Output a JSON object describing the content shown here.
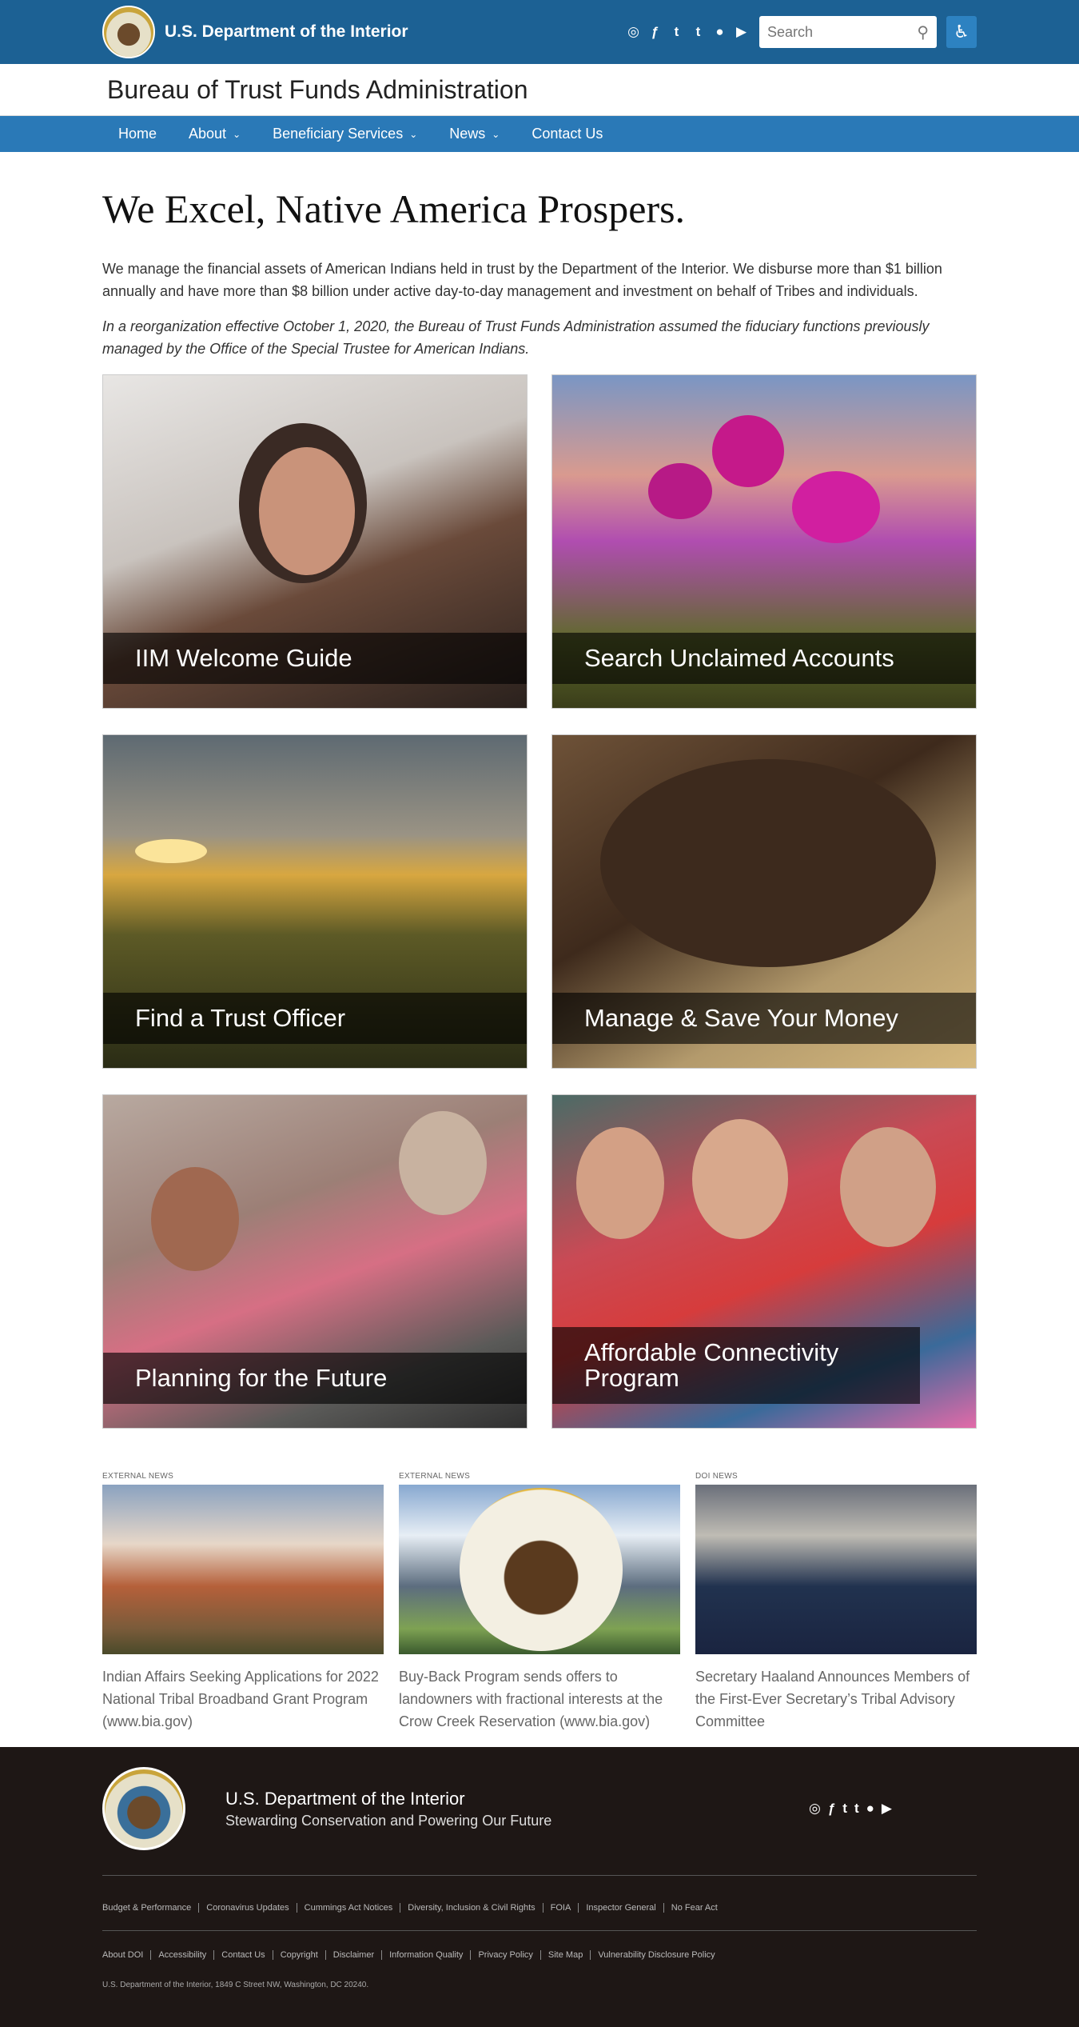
{
  "header": {
    "dept_name": "U.S. Department of the Interior",
    "search_placeholder": "Search",
    "social_icons": [
      "instagram-icon",
      "facebook-icon",
      "twitter-icon",
      "tumblr-icon",
      "flickr-icon",
      "youtube-icon"
    ],
    "bureau_name": "Bureau of Trust Funds Administration"
  },
  "nav": {
    "items": [
      {
        "label": "Home"
      },
      {
        "label": "About"
      },
      {
        "label": "Beneficiary Services"
      },
      {
        "label": "News"
      },
      {
        "label": "Contact Us"
      }
    ]
  },
  "main": {
    "headline": "We Excel, Native America Prospers.",
    "para1": "We manage the financial assets of American Indians held in trust by the Department of the Interior. We disburse more than $1 billion annually and have more than $8 billion under active day-to-day management and investment on behalf of Tribes and individuals.",
    "para2_prefix": "In a ",
    "para2_link": "reorganization effective October 1, 2020",
    "para2_suffix": ", the Bureau of Trust Funds Administration assumed the fiduciary functions previously managed by the Office of the Special Trustee for American Indians.",
    "tiles": [
      {
        "label": "IIM Welcome Guide"
      },
      {
        "label": "Search Unclaimed Accounts"
      },
      {
        "label": "Find a Trust Officer"
      },
      {
        "label": "Manage & Save Your Money"
      },
      {
        "label": "Planning for the Future"
      },
      {
        "label": "Affordable Connectivity Program"
      }
    ]
  },
  "news": [
    {
      "tag": "EXTERNAL NEWS",
      "title": "Indian Affairs Seeking Applications for 2022 National Tribal Broadband Grant Program (www.bia.gov)"
    },
    {
      "tag": "EXTERNAL NEWS",
      "title": "Buy-Back Program sends offers to landowners with fractional interests at the Crow Creek Reservation (www.bia.gov)"
    },
    {
      "tag": "DOI NEWS",
      "title": "Secretary Haaland Announces Members of the First-Ever Secretary’s Tribal Advisory Committee"
    }
  ],
  "footer": {
    "dept_name": "U.S. Department of the Interior",
    "tagline": "Stewarding Conservation and Powering Our Future",
    "links_row1": [
      "Budget & Performance",
      "Coronavirus Updates",
      "Cummings Act Notices",
      "Diversity, Inclusion & Civil Rights",
      "FOIA",
      "Inspector General",
      "No Fear Act"
    ],
    "links_row2": [
      "About DOI",
      "Accessibility",
      "Contact Us",
      "Copyright",
      "Disclaimer",
      "Information Quality",
      "Privacy Policy",
      "Site Map",
      "Vulnerability Disclosure Policy"
    ],
    "address": "U.S. Department of the Interior, 1849 C Street NW, Washington, DC 20240."
  }
}
